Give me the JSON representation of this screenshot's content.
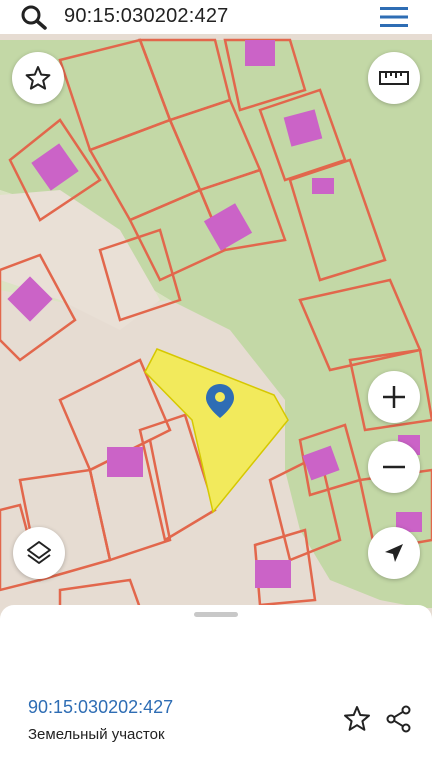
{
  "search": {
    "query": "90:15:030202:427"
  },
  "colors": {
    "parcel_outline": "#e2674c",
    "building": "#cb63c7",
    "selected_parcel": "#f2ea5c",
    "forest": "#c3d8a6",
    "marker": "#2e6db4"
  },
  "map": {
    "controls": [
      "star-icon",
      "ruler-icon",
      "zoom-in-icon",
      "zoom-out-icon",
      "layers-icon",
      "locate-arrow-icon"
    ]
  },
  "selected_object": {
    "cadastral_number": "90:15:030202:427",
    "type": "Земельный участок"
  }
}
